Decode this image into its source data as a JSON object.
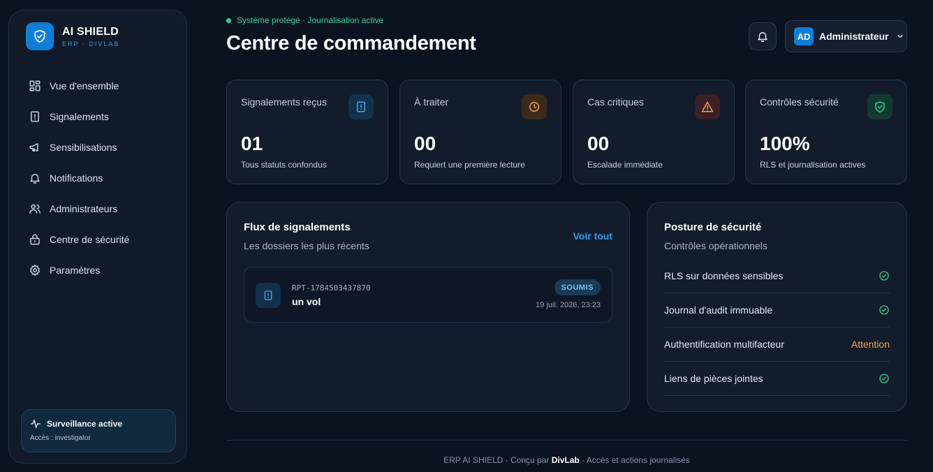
{
  "brand": {
    "title": "AI SHIELD",
    "subtitle": "ERP · DIVLAB"
  },
  "sidebar": {
    "items": [
      {
        "label": "Vue d'ensemble",
        "icon": "grid-icon"
      },
      {
        "label": "Signalements",
        "icon": "alert-file-icon"
      },
      {
        "label": "Sensibilisations",
        "icon": "megaphone-icon"
      },
      {
        "label": "Notifications",
        "icon": "bell-icon"
      },
      {
        "label": "Administrateurs",
        "icon": "users-icon"
      },
      {
        "label": "Centre de sécurité",
        "icon": "lock-icon"
      },
      {
        "label": "Paramètres",
        "icon": "gear-icon"
      }
    ],
    "watch": {
      "title": "Surveillance active",
      "subtitle": "Accès : investigator"
    }
  },
  "header": {
    "status": "Système protégé · Journalisation active",
    "title": "Centre de commandement",
    "user": {
      "initials": "AD",
      "name": "Administrateur"
    }
  },
  "stats": [
    {
      "label": "Signalements reçus",
      "value": "01",
      "note": "Tous statuts confondus",
      "icon": "alert-file-icon",
      "color": "#3fa6f5"
    },
    {
      "label": "À traiter",
      "value": "00",
      "note": "Requiert une première lecture",
      "icon": "clock-icon",
      "color": "#f0a54a"
    },
    {
      "label": "Cas critiques",
      "value": "00",
      "note": "Escalade immédiate",
      "icon": "warning-icon",
      "color": "#f08a4a"
    },
    {
      "label": "Contrôles sécurité",
      "value": "100%",
      "note": "RLS et journalisation actives",
      "icon": "shield-icon",
      "color": "#2fd08f"
    }
  ],
  "feed": {
    "title": "Flux de signalements",
    "subtitle": "Les dossiers les plus récents",
    "see_all": "Voir tout",
    "reports": [
      {
        "id": "RPT-1784503437870",
        "title": "un vol",
        "status": "SOUMIS",
        "date": "19 juil. 2026, 23:23"
      }
    ]
  },
  "posture": {
    "title": "Posture de sécurité",
    "subtitle": "Contrôles opérationnels",
    "checks": [
      {
        "label": "RLS sur données sensibles",
        "state": "ok"
      },
      {
        "label": "Journal d'audit immuable",
        "state": "ok"
      },
      {
        "label": "Authentification multifacteur",
        "state": "attention",
        "state_label": "Attention"
      },
      {
        "label": "Liens de pièces jointes",
        "state": "ok"
      }
    ]
  },
  "footer": {
    "left": "ERP AI SHIELD · Conçu par",
    "brand": "DivLab",
    "right": "· Accès et actions journalisés"
  },
  "colors": {
    "accent": "#0e7fd8",
    "success": "#2fd08f",
    "warning": "#f0a54a",
    "background": "#0b1220"
  }
}
